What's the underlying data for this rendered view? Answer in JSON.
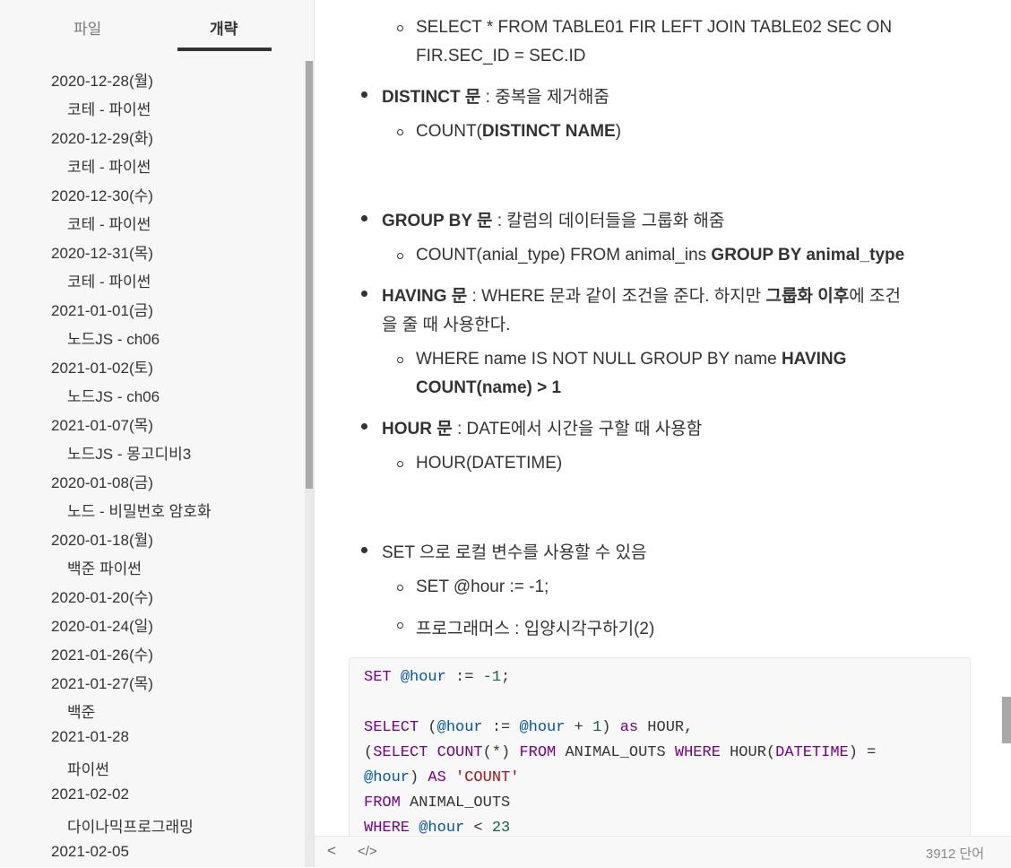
{
  "sidebar": {
    "tabs": {
      "files": "파일",
      "outline": "개략"
    },
    "items": [
      {
        "text": "2020-12-28(월)",
        "level": 1
      },
      {
        "text": "코테 - 파이썬",
        "level": 2
      },
      {
        "text": "2020-12-29(화)",
        "level": 1
      },
      {
        "text": "코테 - 파이썬",
        "level": 2
      },
      {
        "text": "2020-12-30(수)",
        "level": 1
      },
      {
        "text": "코테 - 파이썬",
        "level": 2
      },
      {
        "text": "2020-12-31(목)",
        "level": 1
      },
      {
        "text": "코테 - 파이썬",
        "level": 2
      },
      {
        "text": "2021-01-01(금)",
        "level": 1
      },
      {
        "text": "노드JS - ch06",
        "level": 2
      },
      {
        "text": "2021-01-02(토)",
        "level": 1
      },
      {
        "text": "노드JS - ch06",
        "level": 2
      },
      {
        "text": "2021-01-07(목)",
        "level": 1
      },
      {
        "text": "노드JS - 몽고디비3",
        "level": 2
      },
      {
        "text": "2020-01-08(금)",
        "level": 1
      },
      {
        "text": "노드 - 비밀번호 암호화",
        "level": 2
      },
      {
        "text": "2020-01-18(월)",
        "level": 1
      },
      {
        "text": "백준 파이썬",
        "level": 2
      },
      {
        "text": "2020-01-20(수)",
        "level": 1
      },
      {
        "text": "2020-01-24(일)",
        "level": 1
      },
      {
        "text": "2021-01-26(수)",
        "level": 1
      },
      {
        "text": "2021-01-27(목)",
        "level": 1
      },
      {
        "text": "백준",
        "level": 2
      },
      {
        "text": "2021-01-28",
        "level": 1
      },
      {
        "text": "파이썬",
        "level": 2
      },
      {
        "text": "2021-02-02",
        "level": 1
      },
      {
        "text": "다이나믹프로그래밍",
        "level": 2
      },
      {
        "text": "2021-02-05",
        "level": 1
      }
    ]
  },
  "content": {
    "join_sql_1": "SELECT * FROM TABLE01 FIR LEFT JOIN TABLE02 SEC ON",
    "join_sql_2": "FIR.SEC_ID = SEC.ID",
    "distinct_title": "DISTINCT 문",
    "distinct_desc": " : 중복을 제거해줌",
    "distinct_ex_a": "COUNT(",
    "distinct_ex_b": "DISTINCT NAME",
    "distinct_ex_c": ")",
    "groupby_title": "GROUP BY 문",
    "groupby_desc": " : 칼럼의 데이터들을 그룹화 해줌",
    "groupby_ex_a": "COUNT(anial_type) FROM animal_ins ",
    "groupby_ex_b": "GROUP BY animal_type",
    "having_title": "HAVING 문",
    "having_desc_a": " : WHERE 문과 같이 조건을 준다. 하지만 ",
    "having_desc_b": "그룹화 이후",
    "having_desc_c": "에 조건",
    "having_desc_2": "을 줄 때 사용한다.",
    "having_ex_a": "WHERE name IS NOT NULL GROUP BY name ",
    "having_ex_b": "HAVING",
    "having_ex_2": "COUNT(name) > 1",
    "hour_title": "HOUR 문",
    "hour_desc": " : DATE에서 시간을 구할 때 사용함",
    "hour_ex": "HOUR(DATETIME)",
    "set_desc": "SET 으로 로컬 변수를 사용할 수 있음",
    "set_ex": "SET @hour := -1;",
    "programmers": "프로그래머스 : 입양시각구하기(2)"
  },
  "code": {
    "l1": {
      "kw": "SET",
      "v": "@hour",
      "op": " := ",
      "n": "-1",
      ";": ";"
    },
    "l3": {
      "kw": "SELECT",
      "p": " (",
      "v1": "@hour",
      "op": " := ",
      "v2": "@hour",
      "plus": " + ",
      "n": "1",
      "close": ") ",
      "as": "as",
      "rest": " HOUR,"
    },
    "l4": {
      "p": "(",
      "kw1": "SELECT",
      "sp": " ",
      "fn": "COUNT",
      "star": "(*) ",
      "kw2": "FROM",
      "tbl": " ANIMAL_OUTS ",
      "kw3": "WHERE",
      "sp2": " ",
      "fn2": "HOUR",
      "po": "(",
      "dt": "DATETIME",
      "pc": ") ="
    },
    "l5": {
      "v": "@hour",
      "close": ") ",
      "as": "AS",
      "sp": " ",
      "str": "'COUNT'"
    },
    "l6": {
      "kw": "FROM",
      "rest": " ANIMAL_OUTS"
    },
    "l7": {
      "kw": "WHERE",
      "sp": " ",
      "v": "@hour",
      "op": " < ",
      "n": "23"
    }
  },
  "footer": {
    "back": "<",
    "source": "</>",
    "word_count": "3912 단어"
  }
}
